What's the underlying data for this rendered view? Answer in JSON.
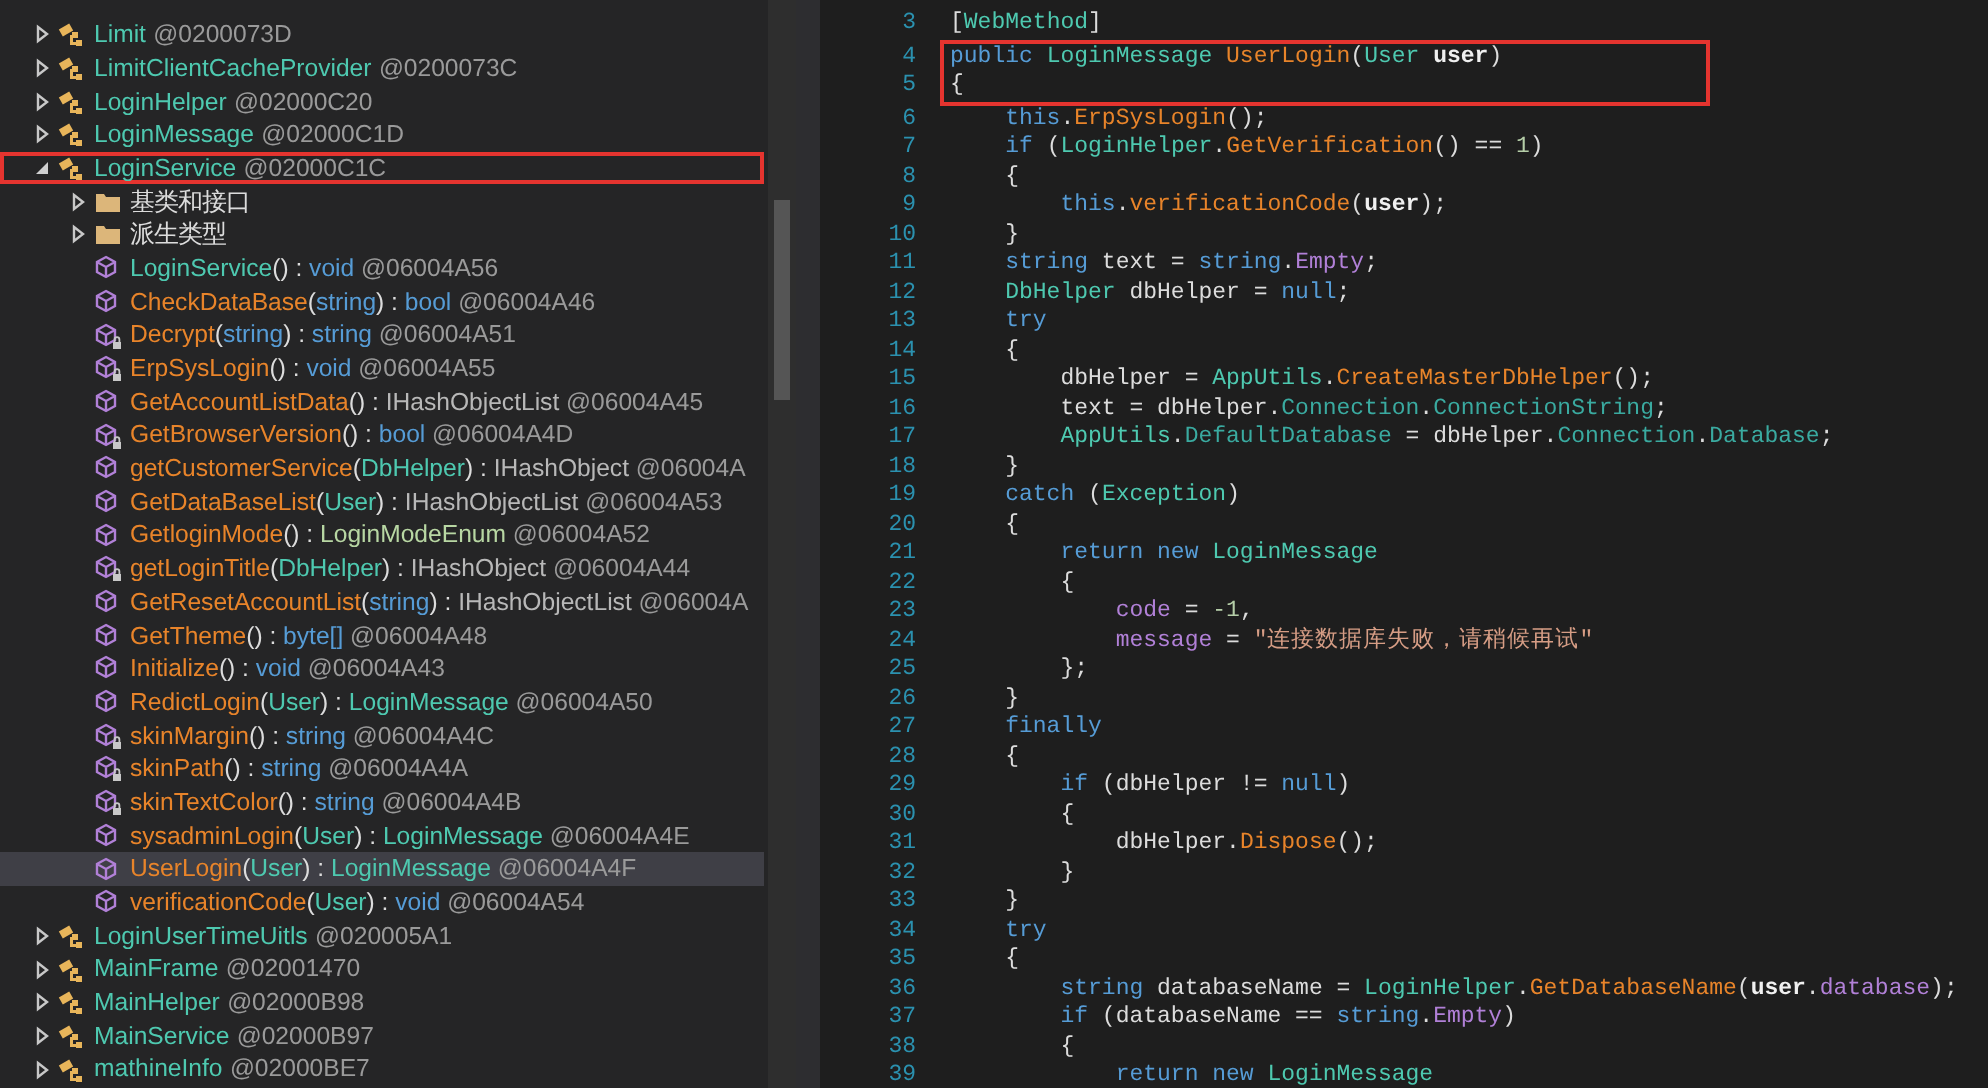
{
  "tree": [
    {
      "kind": "type",
      "name": "Limit",
      "token": "@0200073D",
      "expanded": false,
      "highlighted": false
    },
    {
      "kind": "type",
      "name": "LimitClientCacheProvider",
      "token": "@0200073C",
      "expanded": false,
      "highlighted": false
    },
    {
      "kind": "type",
      "name": "LoginHelper",
      "token": "@02000C20",
      "expanded": false,
      "highlighted": false
    },
    {
      "kind": "type",
      "name": "LoginMessage",
      "token": "@02000C1D",
      "expanded": false,
      "highlighted": false
    },
    {
      "kind": "type",
      "name": "LoginService",
      "token": "@02000C1C",
      "expanded": true,
      "highlighted": true,
      "children": [
        {
          "kind": "folder",
          "name": "基类和接口",
          "expanded": false
        },
        {
          "kind": "folder",
          "name": "派生类型",
          "expanded": false
        },
        {
          "kind": "member",
          "private": false,
          "selected": false,
          "parts": [
            {
              "text": "LoginService",
              "kind": "type"
            },
            {
              "text": "() : ",
              "kind": "plain"
            },
            {
              "text": "void",
              "kind": "keyword"
            },
            {
              "text": " @06004A56",
              "kind": "token"
            }
          ]
        },
        {
          "kind": "member",
          "private": false,
          "selected": false,
          "parts": [
            {
              "text": "CheckDataBase",
              "kind": "method"
            },
            {
              "text": "(",
              "kind": "plain"
            },
            {
              "text": "string",
              "kind": "keyword"
            },
            {
              "text": ") : ",
              "kind": "plain"
            },
            {
              "text": "bool",
              "kind": "keyword"
            },
            {
              "text": " @06004A46",
              "kind": "token"
            }
          ]
        },
        {
          "kind": "member",
          "private": true,
          "selected": false,
          "parts": [
            {
              "text": "Decrypt",
              "kind": "method"
            },
            {
              "text": "(",
              "kind": "plain"
            },
            {
              "text": "string",
              "kind": "keyword"
            },
            {
              "text": ") : ",
              "kind": "plain"
            },
            {
              "text": "string",
              "kind": "keyword"
            },
            {
              "text": " @06004A51",
              "kind": "token"
            }
          ]
        },
        {
          "kind": "member",
          "private": true,
          "selected": false,
          "parts": [
            {
              "text": "ErpSysLogin",
              "kind": "method"
            },
            {
              "text": "() : ",
              "kind": "plain"
            },
            {
              "text": "void",
              "kind": "keyword"
            },
            {
              "text": " @06004A55",
              "kind": "token"
            }
          ]
        },
        {
          "kind": "member",
          "private": false,
          "selected": false,
          "parts": [
            {
              "text": "GetAccountListData",
              "kind": "method"
            },
            {
              "text": "() : ",
              "kind": "plain"
            },
            {
              "text": "IHashObjectList",
              "kind": "interface"
            },
            {
              "text": " @06004A45",
              "kind": "token"
            }
          ]
        },
        {
          "kind": "member",
          "private": true,
          "selected": false,
          "parts": [
            {
              "text": "GetBrowserVersion",
              "kind": "method"
            },
            {
              "text": "() : ",
              "kind": "plain"
            },
            {
              "text": "bool",
              "kind": "keyword"
            },
            {
              "text": " @06004A4D",
              "kind": "token"
            }
          ]
        },
        {
          "kind": "member",
          "private": false,
          "selected": false,
          "parts": [
            {
              "text": "getCustomerService",
              "kind": "method"
            },
            {
              "text": "(",
              "kind": "plain"
            },
            {
              "text": "DbHelper",
              "kind": "type"
            },
            {
              "text": ") : ",
              "kind": "plain"
            },
            {
              "text": "IHashObject",
              "kind": "interface"
            },
            {
              "text": " @06004A",
              "kind": "token"
            }
          ]
        },
        {
          "kind": "member",
          "private": false,
          "selected": false,
          "parts": [
            {
              "text": "GetDataBaseList",
              "kind": "method"
            },
            {
              "text": "(",
              "kind": "plain"
            },
            {
              "text": "User",
              "kind": "type"
            },
            {
              "text": ") : ",
              "kind": "plain"
            },
            {
              "text": "IHashObjectList",
              "kind": "interface"
            },
            {
              "text": " @06004A53",
              "kind": "token"
            }
          ]
        },
        {
          "kind": "member",
          "private": false,
          "selected": false,
          "parts": [
            {
              "text": "GetloginMode",
              "kind": "method"
            },
            {
              "text": "() : ",
              "kind": "plain"
            },
            {
              "text": "LoginModeEnum",
              "kind": "enum"
            },
            {
              "text": " @06004A52",
              "kind": "token"
            }
          ]
        },
        {
          "kind": "member",
          "private": true,
          "selected": false,
          "parts": [
            {
              "text": "getLoginTitle",
              "kind": "method"
            },
            {
              "text": "(",
              "kind": "plain"
            },
            {
              "text": "DbHelper",
              "kind": "type"
            },
            {
              "text": ") : ",
              "kind": "plain"
            },
            {
              "text": "IHashObject",
              "kind": "interface"
            },
            {
              "text": " @06004A44",
              "kind": "token"
            }
          ]
        },
        {
          "kind": "member",
          "private": false,
          "selected": false,
          "parts": [
            {
              "text": "GetResetAccountList",
              "kind": "method"
            },
            {
              "text": "(",
              "kind": "plain"
            },
            {
              "text": "string",
              "kind": "keyword"
            },
            {
              "text": ") : ",
              "kind": "plain"
            },
            {
              "text": "IHashObjectList",
              "kind": "interface"
            },
            {
              "text": " @06004A",
              "kind": "token"
            }
          ]
        },
        {
          "kind": "member",
          "private": false,
          "selected": false,
          "parts": [
            {
              "text": "GetTheme",
              "kind": "method"
            },
            {
              "text": "() : ",
              "kind": "plain"
            },
            {
              "text": "byte[]",
              "kind": "keyword"
            },
            {
              "text": " @06004A48",
              "kind": "token"
            }
          ]
        },
        {
          "kind": "member",
          "private": false,
          "selected": false,
          "parts": [
            {
              "text": "Initialize",
              "kind": "method"
            },
            {
              "text": "() : ",
              "kind": "plain"
            },
            {
              "text": "void",
              "kind": "keyword"
            },
            {
              "text": " @06004A43",
              "kind": "token"
            }
          ]
        },
        {
          "kind": "member",
          "private": false,
          "selected": false,
          "parts": [
            {
              "text": "RedictLogin",
              "kind": "method"
            },
            {
              "text": "(",
              "kind": "plain"
            },
            {
              "text": "User",
              "kind": "type"
            },
            {
              "text": ") : ",
              "kind": "plain"
            },
            {
              "text": "LoginMessage",
              "kind": "type"
            },
            {
              "text": " @06004A50",
              "kind": "token"
            }
          ]
        },
        {
          "kind": "member",
          "private": true,
          "selected": false,
          "parts": [
            {
              "text": "skinMargin",
              "kind": "method"
            },
            {
              "text": "() : ",
              "kind": "plain"
            },
            {
              "text": "string",
              "kind": "keyword"
            },
            {
              "text": " @06004A4C",
              "kind": "token"
            }
          ]
        },
        {
          "kind": "member",
          "private": true,
          "selected": false,
          "parts": [
            {
              "text": "skinPath",
              "kind": "method"
            },
            {
              "text": "() : ",
              "kind": "plain"
            },
            {
              "text": "string",
              "kind": "keyword"
            },
            {
              "text": " @06004A4A",
              "kind": "token"
            }
          ]
        },
        {
          "kind": "member",
          "private": true,
          "selected": false,
          "parts": [
            {
              "text": "skinTextColor",
              "kind": "method"
            },
            {
              "text": "() : ",
              "kind": "plain"
            },
            {
              "text": "string",
              "kind": "keyword"
            },
            {
              "text": " @06004A4B",
              "kind": "token"
            }
          ]
        },
        {
          "kind": "member",
          "private": false,
          "selected": false,
          "parts": [
            {
              "text": "sysadminLogin",
              "kind": "method"
            },
            {
              "text": "(",
              "kind": "plain"
            },
            {
              "text": "User",
              "kind": "type"
            },
            {
              "text": ") : ",
              "kind": "plain"
            },
            {
              "text": "LoginMessage",
              "kind": "type"
            },
            {
              "text": " @06004A4E",
              "kind": "token"
            }
          ]
        },
        {
          "kind": "member",
          "private": false,
          "selected": true,
          "parts": [
            {
              "text": "UserLogin",
              "kind": "method"
            },
            {
              "text": "(",
              "kind": "plain"
            },
            {
              "text": "User",
              "kind": "type"
            },
            {
              "text": ") : ",
              "kind": "plain"
            },
            {
              "text": "LoginMessage",
              "kind": "type"
            },
            {
              "text": " @06004A4F",
              "kind": "token"
            }
          ]
        },
        {
          "kind": "member",
          "private": false,
          "selected": false,
          "parts": [
            {
              "text": "verificationCode",
              "kind": "method"
            },
            {
              "text": "(",
              "kind": "plain"
            },
            {
              "text": "User",
              "kind": "type"
            },
            {
              "text": ") : ",
              "kind": "plain"
            },
            {
              "text": "void",
              "kind": "keyword"
            },
            {
              "text": " @06004A54",
              "kind": "token"
            }
          ]
        }
      ]
    },
    {
      "kind": "type",
      "name": "LoginUserTimeUitls",
      "token": "@020005A1",
      "expanded": false,
      "highlighted": false
    },
    {
      "kind": "type",
      "name": "MainFrame",
      "token": "@02001470",
      "expanded": false,
      "highlighted": false
    },
    {
      "kind": "type",
      "name": "MainHelper",
      "token": "@02000B98",
      "expanded": false,
      "highlighted": false
    },
    {
      "kind": "type",
      "name": "MainService",
      "token": "@02000B97",
      "expanded": false,
      "highlighted": false
    },
    {
      "kind": "type",
      "name": "mathineInfo",
      "token": "@02000BE7",
      "expanded": false,
      "highlighted": false
    }
  ],
  "code": [
    {
      "number": "3",
      "highlighted": false,
      "tokens": [
        {
          "text": "[",
          "kind": "plain"
        },
        {
          "text": "WebMethod",
          "kind": "type"
        },
        {
          "text": "]",
          "kind": "plain"
        }
      ]
    },
    {
      "number": "4",
      "highlighted": true,
      "tokens": [
        {
          "text": "public ",
          "kind": "keyword"
        },
        {
          "text": "LoginMessage ",
          "kind": "type"
        },
        {
          "text": "UserLogin",
          "kind": "method"
        },
        {
          "text": "(",
          "kind": "plain"
        },
        {
          "text": "User ",
          "kind": "type"
        },
        {
          "text": "user",
          "kind": "param"
        },
        {
          "text": ")",
          "kind": "plain"
        }
      ]
    },
    {
      "number": "5",
      "highlighted": true,
      "tokens": [
        {
          "text": "{",
          "kind": "plain"
        }
      ]
    },
    {
      "number": "6",
      "highlighted": false,
      "tokens": [
        {
          "text": "    this",
          "kind": "keyword"
        },
        {
          "text": ".",
          "kind": "plain"
        },
        {
          "text": "ErpSysLogin",
          "kind": "method"
        },
        {
          "text": "();",
          "kind": "plain"
        }
      ]
    },
    {
      "number": "7",
      "highlighted": false,
      "tokens": [
        {
          "text": "    if",
          "kind": "keyword"
        },
        {
          "text": " (",
          "kind": "plain"
        },
        {
          "text": "LoginHelper",
          "kind": "type"
        },
        {
          "text": ".",
          "kind": "plain"
        },
        {
          "text": "GetVerification",
          "kind": "method"
        },
        {
          "text": "() == ",
          "kind": "plain"
        },
        {
          "text": "1",
          "kind": "number"
        },
        {
          "text": ")",
          "kind": "plain"
        }
      ]
    },
    {
      "number": "8",
      "highlighted": false,
      "tokens": [
        {
          "text": "    {",
          "kind": "plain"
        }
      ]
    },
    {
      "number": "9",
      "highlighted": false,
      "tokens": [
        {
          "text": "        this",
          "kind": "keyword"
        },
        {
          "text": ".",
          "kind": "plain"
        },
        {
          "text": "verificationCode",
          "kind": "method"
        },
        {
          "text": "(",
          "kind": "plain"
        },
        {
          "text": "user",
          "kind": "param"
        },
        {
          "text": ");",
          "kind": "plain"
        }
      ]
    },
    {
      "number": "10",
      "highlighted": false,
      "tokens": [
        {
          "text": "    }",
          "kind": "plain"
        }
      ]
    },
    {
      "number": "11",
      "highlighted": false,
      "tokens": [
        {
          "text": "    string",
          "kind": "keyword"
        },
        {
          "text": " text = ",
          "kind": "plain"
        },
        {
          "text": "string",
          "kind": "keyword"
        },
        {
          "text": ".",
          "kind": "plain"
        },
        {
          "text": "Empty",
          "kind": "field"
        },
        {
          "text": ";",
          "kind": "plain"
        }
      ]
    },
    {
      "number": "12",
      "highlighted": false,
      "tokens": [
        {
          "text": "    DbHelper",
          "kind": "type"
        },
        {
          "text": " dbHelper = ",
          "kind": "plain"
        },
        {
          "text": "null",
          "kind": "keyword"
        },
        {
          "text": ";",
          "kind": "plain"
        }
      ]
    },
    {
      "number": "13",
      "highlighted": false,
      "tokens": [
        {
          "text": "    try",
          "kind": "keyword"
        }
      ]
    },
    {
      "number": "14",
      "highlighted": false,
      "tokens": [
        {
          "text": "    {",
          "kind": "plain"
        }
      ]
    },
    {
      "number": "15",
      "highlighted": false,
      "tokens": [
        {
          "text": "        dbHelper = ",
          "kind": "plain"
        },
        {
          "text": "AppUtils",
          "kind": "type"
        },
        {
          "text": ".",
          "kind": "plain"
        },
        {
          "text": "CreateMasterDbHelper",
          "kind": "method"
        },
        {
          "text": "();",
          "kind": "plain"
        }
      ]
    },
    {
      "number": "16",
      "highlighted": false,
      "tokens": [
        {
          "text": "        text = dbHelper.",
          "kind": "plain"
        },
        {
          "text": "Connection",
          "kind": "property"
        },
        {
          "text": ".",
          "kind": "plain"
        },
        {
          "text": "ConnectionString",
          "kind": "property"
        },
        {
          "text": ";",
          "kind": "plain"
        }
      ]
    },
    {
      "number": "17",
      "highlighted": false,
      "tokens": [
        {
          "text": "        AppUtils",
          "kind": "type"
        },
        {
          "text": ".",
          "kind": "plain"
        },
        {
          "text": "DefaultDatabase",
          "kind": "property"
        },
        {
          "text": " = dbHelper.",
          "kind": "plain"
        },
        {
          "text": "Connection",
          "kind": "property"
        },
        {
          "text": ".",
          "kind": "plain"
        },
        {
          "text": "Database",
          "kind": "property"
        },
        {
          "text": ";",
          "kind": "plain"
        }
      ]
    },
    {
      "number": "18",
      "highlighted": false,
      "tokens": [
        {
          "text": "    }",
          "kind": "plain"
        }
      ]
    },
    {
      "number": "19",
      "highlighted": false,
      "tokens": [
        {
          "text": "    catch",
          "kind": "keyword"
        },
        {
          "text": " (",
          "kind": "plain"
        },
        {
          "text": "Exception",
          "kind": "type"
        },
        {
          "text": ")",
          "kind": "plain"
        }
      ]
    },
    {
      "number": "20",
      "highlighted": false,
      "tokens": [
        {
          "text": "    {",
          "kind": "plain"
        }
      ]
    },
    {
      "number": "21",
      "highlighted": false,
      "tokens": [
        {
          "text": "        return new ",
          "kind": "keyword"
        },
        {
          "text": "LoginMessage",
          "kind": "type"
        }
      ]
    },
    {
      "number": "22",
      "highlighted": false,
      "tokens": [
        {
          "text": "        {",
          "kind": "plain"
        }
      ]
    },
    {
      "number": "23",
      "highlighted": false,
      "tokens": [
        {
          "text": "            code",
          "kind": "field"
        },
        {
          "text": " = ",
          "kind": "plain"
        },
        {
          "text": "-1",
          "kind": "number"
        },
        {
          "text": ",",
          "kind": "plain"
        }
      ]
    },
    {
      "number": "24",
      "highlighted": false,
      "tokens": [
        {
          "text": "            message",
          "kind": "field"
        },
        {
          "text": " = ",
          "kind": "plain"
        },
        {
          "text": "\"连接数据库失败，请稍候再试\"",
          "kind": "string"
        }
      ]
    },
    {
      "number": "25",
      "highlighted": false,
      "tokens": [
        {
          "text": "        };",
          "kind": "plain"
        }
      ]
    },
    {
      "number": "26",
      "highlighted": false,
      "tokens": [
        {
          "text": "    }",
          "kind": "plain"
        }
      ]
    },
    {
      "number": "27",
      "highlighted": false,
      "tokens": [
        {
          "text": "    finally",
          "kind": "keyword"
        }
      ]
    },
    {
      "number": "28",
      "highlighted": false,
      "tokens": [
        {
          "text": "    {",
          "kind": "plain"
        }
      ]
    },
    {
      "number": "29",
      "highlighted": false,
      "tokens": [
        {
          "text": "        if",
          "kind": "keyword"
        },
        {
          "text": " (dbHelper != ",
          "kind": "plain"
        },
        {
          "text": "null",
          "kind": "keyword"
        },
        {
          "text": ")",
          "kind": "plain"
        }
      ]
    },
    {
      "number": "30",
      "highlighted": false,
      "tokens": [
        {
          "text": "        {",
          "kind": "plain"
        }
      ]
    },
    {
      "number": "31",
      "highlighted": false,
      "tokens": [
        {
          "text": "            dbHelper.",
          "kind": "plain"
        },
        {
          "text": "Dispose",
          "kind": "method"
        },
        {
          "text": "();",
          "kind": "plain"
        }
      ]
    },
    {
      "number": "32",
      "highlighted": false,
      "tokens": [
        {
          "text": "        }",
          "kind": "plain"
        }
      ]
    },
    {
      "number": "33",
      "highlighted": false,
      "tokens": [
        {
          "text": "    }",
          "kind": "plain"
        }
      ]
    },
    {
      "number": "34",
      "highlighted": false,
      "tokens": [
        {
          "text": "    try",
          "kind": "keyword"
        }
      ]
    },
    {
      "number": "35",
      "highlighted": false,
      "tokens": [
        {
          "text": "    {",
          "kind": "plain"
        }
      ]
    },
    {
      "number": "36",
      "highlighted": false,
      "tokens": [
        {
          "text": "        string",
          "kind": "keyword"
        },
        {
          "text": " databaseName = ",
          "kind": "plain"
        },
        {
          "text": "LoginHelper",
          "kind": "type"
        },
        {
          "text": ".",
          "kind": "plain"
        },
        {
          "text": "GetDatabaseName",
          "kind": "method"
        },
        {
          "text": "(",
          "kind": "plain"
        },
        {
          "text": "user",
          "kind": "param"
        },
        {
          "text": ".",
          "kind": "plain"
        },
        {
          "text": "database",
          "kind": "field"
        },
        {
          "text": ");",
          "kind": "plain"
        }
      ]
    },
    {
      "number": "37",
      "highlighted": false,
      "tokens": [
        {
          "text": "        if",
          "kind": "keyword"
        },
        {
          "text": " (databaseName == ",
          "kind": "plain"
        },
        {
          "text": "string",
          "kind": "keyword"
        },
        {
          "text": ".",
          "kind": "plain"
        },
        {
          "text": "Empty",
          "kind": "field"
        },
        {
          "text": ")",
          "kind": "plain"
        }
      ]
    },
    {
      "number": "38",
      "highlighted": false,
      "tokens": [
        {
          "text": "        {",
          "kind": "plain"
        }
      ]
    },
    {
      "number": "39",
      "highlighted": false,
      "tokens": [
        {
          "text": "            return new ",
          "kind": "keyword"
        },
        {
          "text": "LoginMessage",
          "kind": "type"
        }
      ]
    }
  ]
}
